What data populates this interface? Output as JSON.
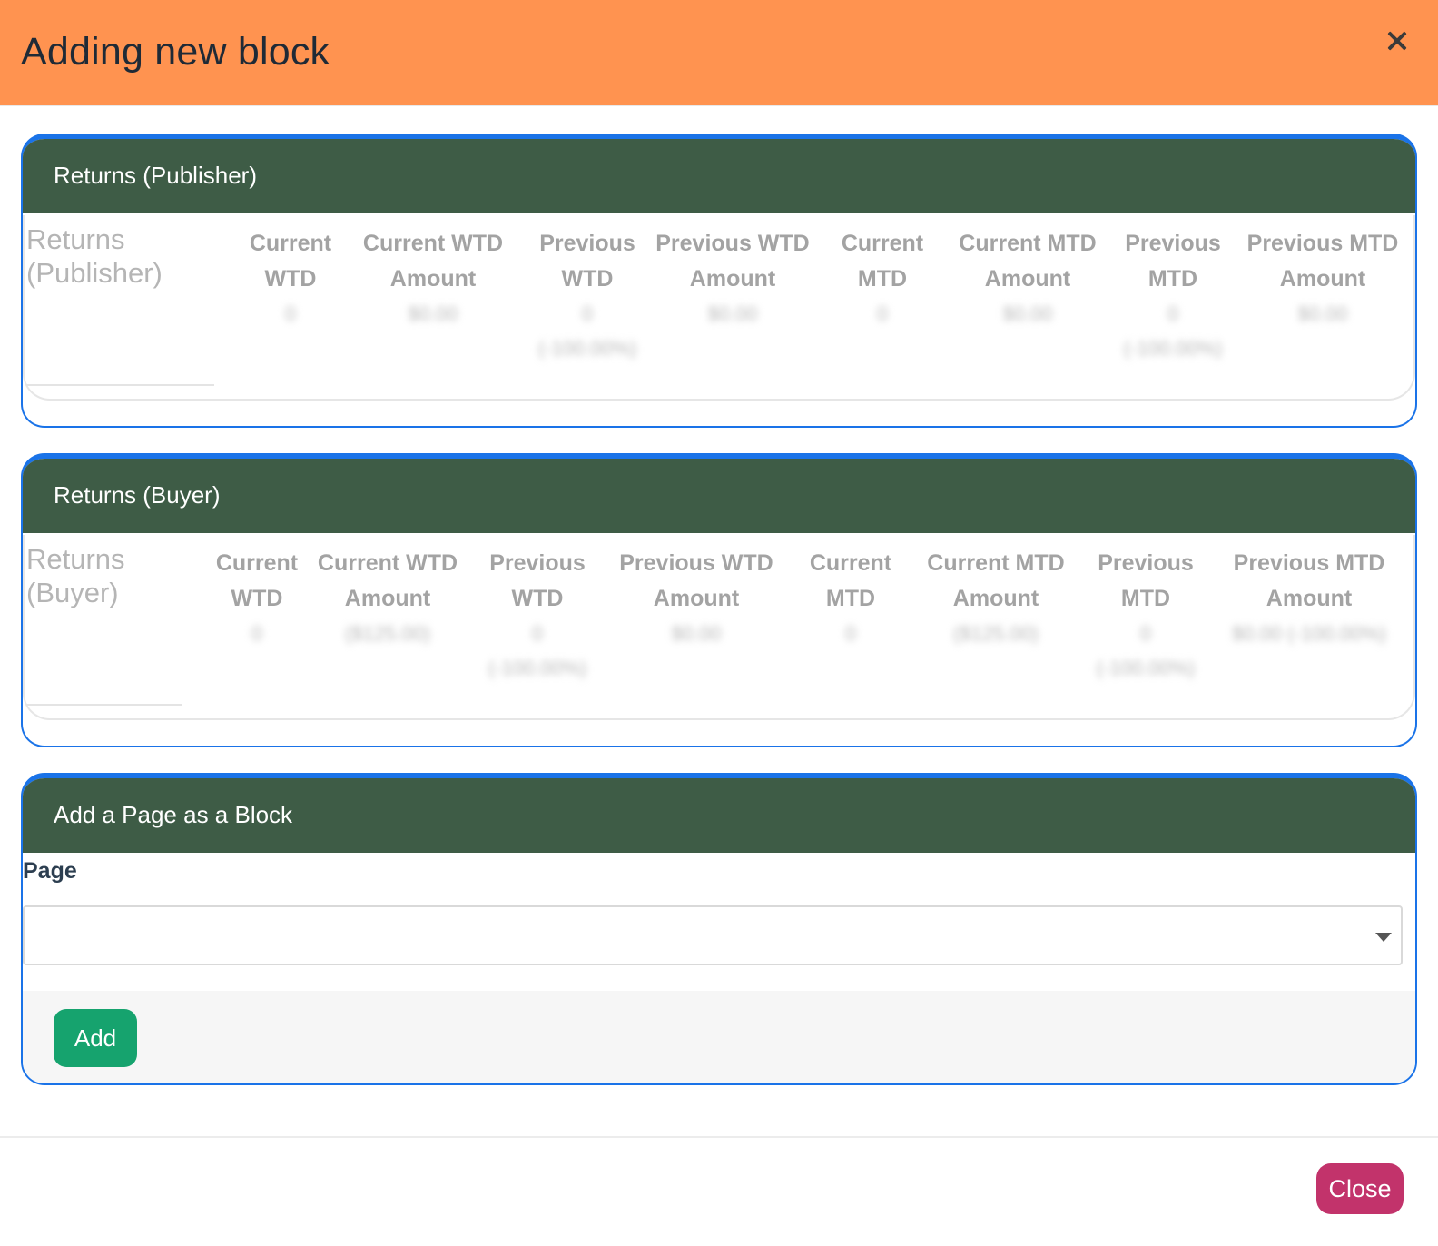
{
  "modal": {
    "title": "Adding new block",
    "close_label": "Close"
  },
  "publisher": {
    "heading": "Returns (Publisher)",
    "row_title_1": "Returns",
    "row_title_2": "(Publisher)",
    "cols": [
      {
        "h1": "Current",
        "h2": "WTD",
        "v1": "0",
        "v2": ""
      },
      {
        "h1": "Current WTD",
        "h2": "Amount",
        "v1": "$0.00",
        "v2": ""
      },
      {
        "h1": "Previous",
        "h2": "WTD",
        "v1": "0",
        "v2": "(-100.00%)"
      },
      {
        "h1": "Previous WTD",
        "h2": "Amount",
        "v1": "$0.00",
        "v2": ""
      },
      {
        "h1": "Current",
        "h2": "MTD",
        "v1": "0",
        "v2": ""
      },
      {
        "h1": "Current MTD",
        "h2": "Amount",
        "v1": "$0.00",
        "v2": ""
      },
      {
        "h1": "Previous",
        "h2": "MTD",
        "v1": "0",
        "v2": "(-100.00%)"
      },
      {
        "h1": "Previous MTD",
        "h2": "Amount",
        "v1": "$0.00",
        "v2": ""
      }
    ]
  },
  "buyer": {
    "heading": "Returns (Buyer)",
    "row_title_1": "Returns",
    "row_title_2": "(Buyer)",
    "cols": [
      {
        "h1": "Current",
        "h2": "WTD",
        "v1": "0",
        "v2": ""
      },
      {
        "h1": "Current WTD",
        "h2": "Amount",
        "v1": "($125.00)",
        "v2": ""
      },
      {
        "h1": "Previous",
        "h2": "WTD",
        "v1": "0",
        "v2": "(-100.00%)"
      },
      {
        "h1": "Previous WTD",
        "h2": "Amount",
        "v1": "$0.00",
        "v2": ""
      },
      {
        "h1": "Current",
        "h2": "MTD",
        "v1": "0",
        "v2": ""
      },
      {
        "h1": "Current MTD",
        "h2": "Amount",
        "v1": "($125.00)",
        "v2": ""
      },
      {
        "h1": "Previous",
        "h2": "MTD",
        "v1": "0",
        "v2": "(-100.00%)"
      },
      {
        "h1": "Previous MTD",
        "h2": "Amount",
        "v1": "$0.00 (-100.00%)",
        "v2": ""
      }
    ]
  },
  "page_block": {
    "heading": "Add a Page as a Block",
    "field_label": "Page",
    "select_value": "",
    "add_label": "Add"
  }
}
